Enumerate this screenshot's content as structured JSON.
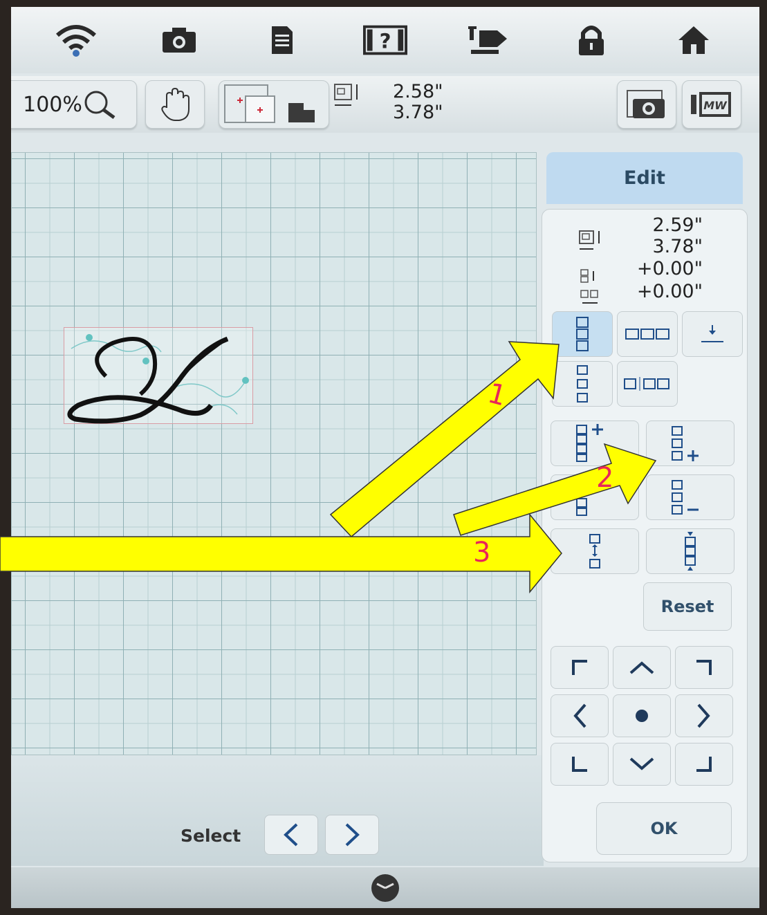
{
  "toolbar": {
    "zoom_label": "100%",
    "design_size": {
      "width": "2.58\"",
      "height": "3.78\""
    }
  },
  "panel": {
    "tab_label": "Edit",
    "size": {
      "width": "2.59\"",
      "height": "3.78\""
    },
    "offset": {
      "vertical": "+0.00\"",
      "horizontal": "+0.00\""
    },
    "reset_label": "Reset",
    "ok_label": "OK"
  },
  "bottom": {
    "select_label": "Select"
  },
  "annotations": {
    "arrow_1": "1",
    "arrow_2": "2",
    "arrow_3": "3",
    "color": "#ffff00",
    "number_color": "#e8265a"
  },
  "icons": [
    "wifi-icon",
    "camera-icon",
    "document-icon",
    "help-icon",
    "sewing-machine-icon",
    "lock-icon",
    "home-icon",
    "magnifier-icon",
    "hand-icon",
    "hoop-icon",
    "size-icon",
    "photo-camera-icon",
    "mw-icon",
    "clock-icon"
  ]
}
